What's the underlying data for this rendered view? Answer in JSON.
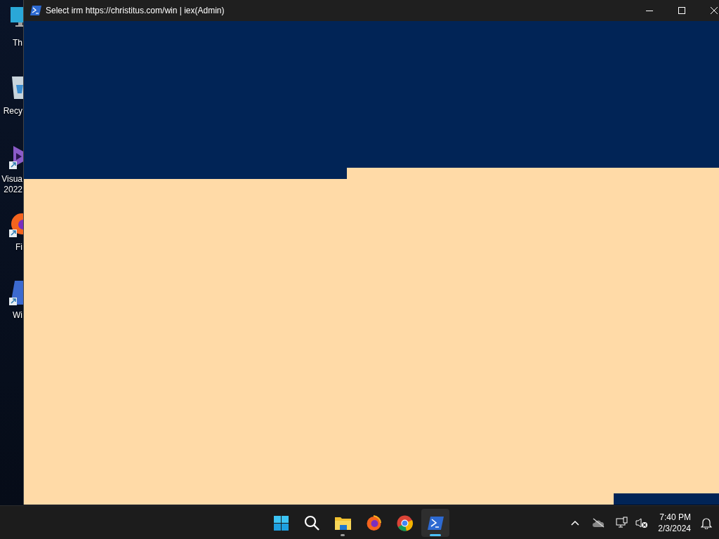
{
  "desktop_icons": [
    {
      "label": "Th",
      "kind": "monitor"
    },
    {
      "label": "Recy",
      "kind": "bin"
    },
    {
      "label": "Visua 2022",
      "kind": "studio"
    },
    {
      "label": "Fi",
      "kind": "firefox"
    },
    {
      "label": "Wi",
      "kind": "winutil"
    }
  ],
  "window": {
    "title": "Select irm https://christitus.com/win | iex(Admin)"
  },
  "taskbar": {
    "apps": [
      {
        "kind": "start",
        "running": false,
        "selected": false
      },
      {
        "kind": "search",
        "running": false,
        "selected": false
      },
      {
        "kind": "explorer",
        "running": true,
        "selected": false
      },
      {
        "kind": "firefox",
        "running": false,
        "selected": false
      },
      {
        "kind": "chrome",
        "running": false,
        "selected": false
      },
      {
        "kind": "powershell",
        "running": true,
        "selected": true
      }
    ],
    "clock": {
      "time": "7:40 PM",
      "date": "2/3/2024"
    }
  }
}
